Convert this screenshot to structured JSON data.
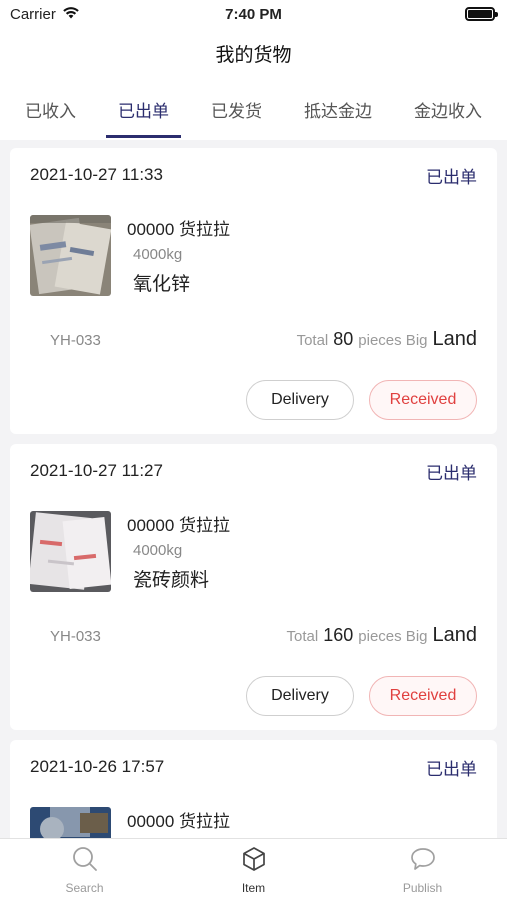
{
  "status_bar": {
    "carrier": "Carrier",
    "time": "7:40 PM"
  },
  "nav": {
    "title": "我的货物"
  },
  "tabs": [
    {
      "label": "已收入"
    },
    {
      "label": "已出单"
    },
    {
      "label": "已发货"
    },
    {
      "label": "抵达金边"
    },
    {
      "label": "金边收入"
    }
  ],
  "active_tab": "已出单",
  "orders": [
    {
      "time": "2021-10-27 11:33",
      "status": "已出单",
      "title": "00000 货拉拉",
      "weight": "4000kg",
      "name": "氧化锌",
      "code": "YH-033",
      "total_label": "Total",
      "count": "80",
      "unit_label": "pieces Big",
      "transport": "Land",
      "delivery_label": "Delivery",
      "received_label": "Received"
    },
    {
      "time": "2021-10-27 11:27",
      "status": "已出单",
      "title": "00000 货拉拉",
      "weight": "4000kg",
      "name": "瓷砖颜料",
      "code": "YH-033",
      "total_label": "Total",
      "count": "160",
      "unit_label": "pieces Big",
      "transport": "Land",
      "delivery_label": "Delivery",
      "received_label": "Received"
    },
    {
      "time": "2021-10-26 17:57",
      "status": "已出单",
      "title": "00000 货拉拉"
    }
  ],
  "tabbar": [
    {
      "label": "Search",
      "icon": "search-icon"
    },
    {
      "label": "Item",
      "icon": "box-icon"
    },
    {
      "label": "Publish",
      "icon": "chat-bubble-icon"
    }
  ],
  "colors": {
    "accent": "#2b2d6e",
    "received": "#e0403f"
  }
}
